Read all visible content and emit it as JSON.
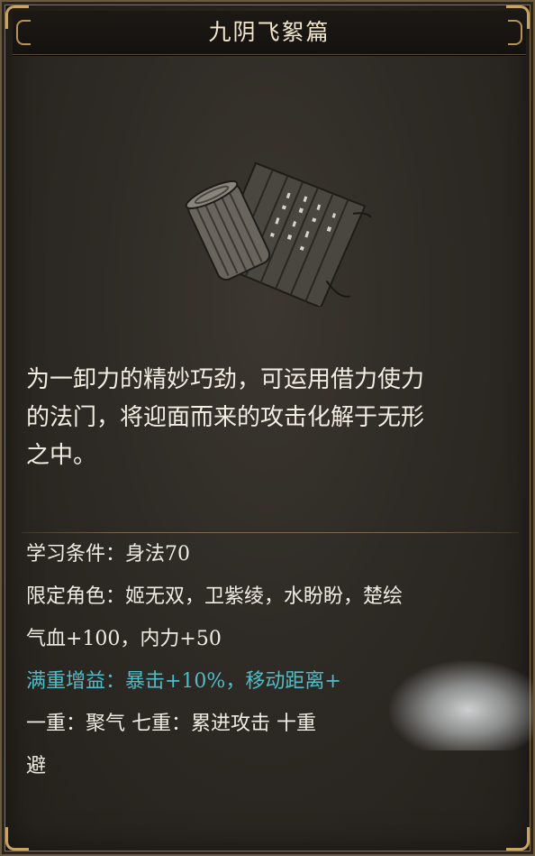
{
  "title": "九阴飞絮篇",
  "item_icon": "bamboo-scroll-icon",
  "description": {
    "line1": "为一卸力的精妙巧劲，可运用借力使力",
    "line2": "的法门，将迎面而来的攻击化解于无形",
    "line3": "之中。"
  },
  "info": {
    "requirement": "学习条件：身法70",
    "characters": "限定角色：姬无双，卫紫绫，水盼盼，楚绘",
    "stats": "气血+100，内力+50",
    "full_bonus": "满重增益：暴击+10%，移动距离+",
    "tiers": "一重：聚气 七重：累进攻击 十重",
    "tiers_cont": "避"
  },
  "colors": {
    "accent_cyan": "#4fbcc8",
    "frame_gold": "#c9a45f",
    "text": "#f3ede2"
  }
}
